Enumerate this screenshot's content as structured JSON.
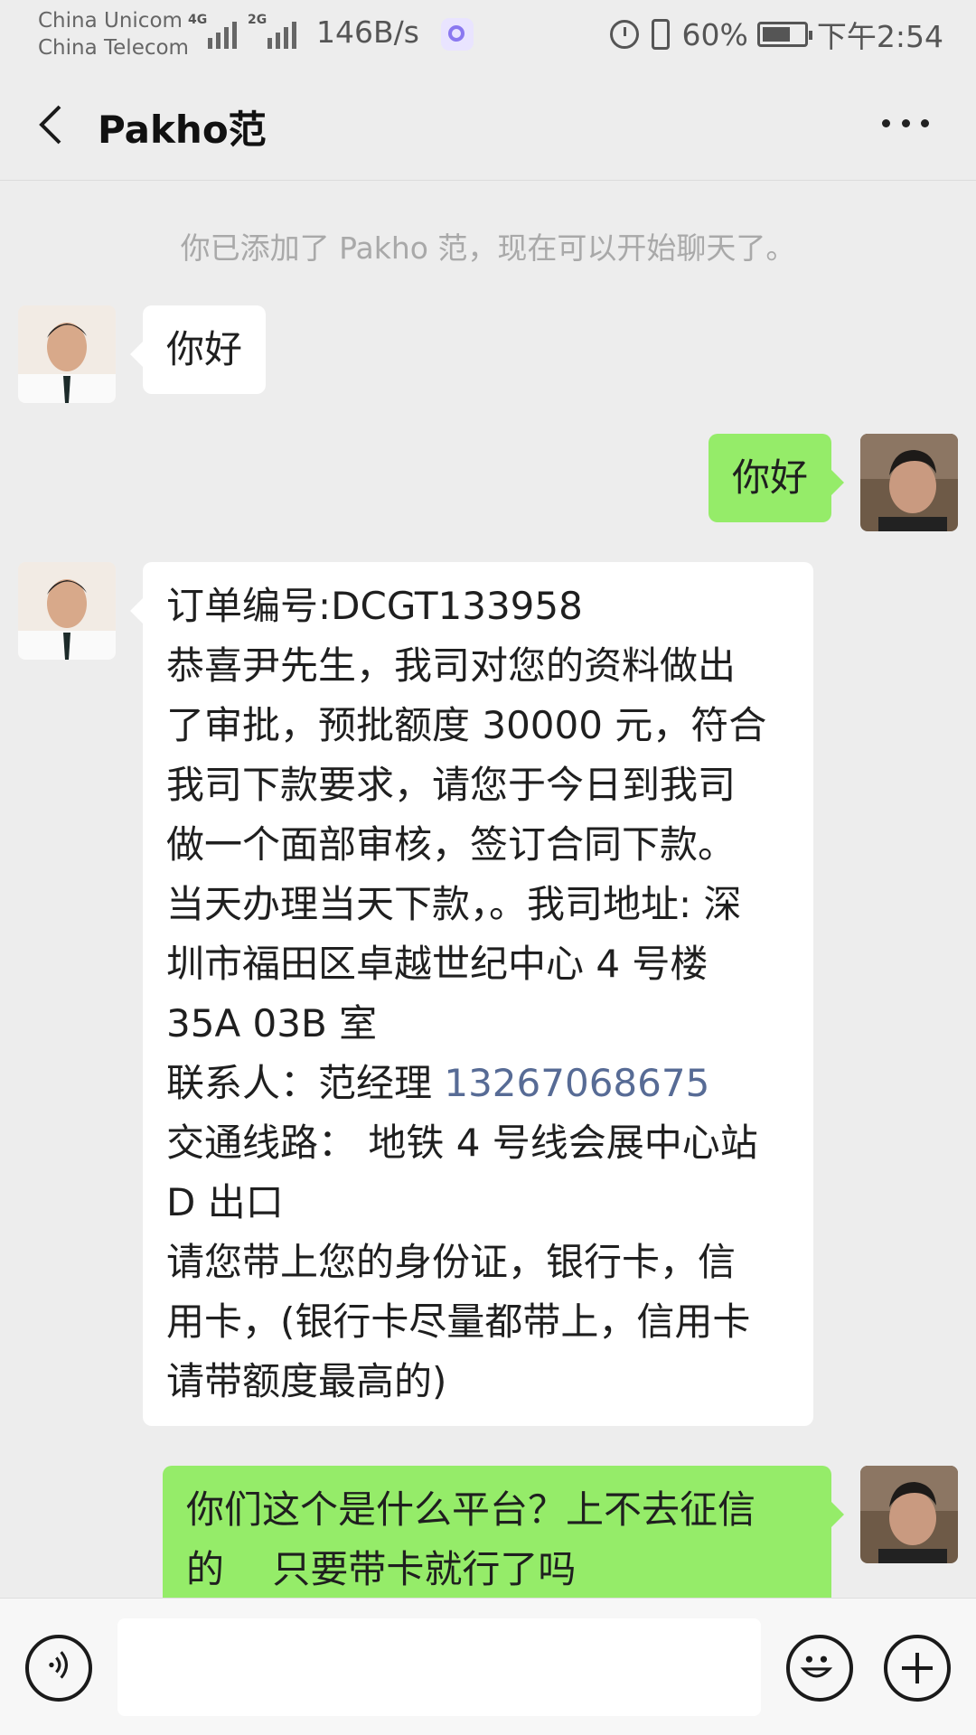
{
  "status_bar": {
    "carrier_1": "China Unicom",
    "carrier_2": "China Telecom",
    "signal_1_type": "4G",
    "signal_2_type": "2G",
    "net_speed": "146B/s",
    "battery": "60%",
    "time": "下午2:54",
    "icons": [
      "alarm-icon",
      "vibrate-icon",
      "battery-icon"
    ]
  },
  "header": {
    "title": "Pakho范",
    "back_icon": "chevron-left-icon",
    "more_icon": "more-dots-icon"
  },
  "chat": {
    "system_message": "你已添加了 Pakho 范，现在可以开始聊天了。",
    "messages": [
      {
        "direction": "in",
        "text": "你好"
      },
      {
        "direction": "out",
        "text": "你好"
      },
      {
        "direction": "in",
        "lines": [
          "订单编号:DCGT133958",
          "恭喜尹先生，我司对您的资料做出",
          "了审批，预批额度 30000 元，符合",
          "我司下款要求，请您于今日到我司",
          "做一个面部审核，签订合同下款。",
          "当天办理当天下款，。我司地址: 深",
          "圳市福田区卓越世纪中心 4 号楼",
          "35A 03B 室"
        ],
        "contact_label": "联系人：范经理 ",
        "contact_phone": "13267068675",
        "lines_after": [
          "交通线路：  地铁 4 号线会展中心站",
          "D 出口",
          "请您带上您的身份证，银行卡，信",
          "用卡，(银行卡尽量都带上，信用卡",
          "请带额度最高的)"
        ]
      },
      {
        "direction": "out",
        "lines": [
          "你们这个是什么平台？上不去征信",
          "的    只要带卡就行了吗"
        ]
      }
    ]
  },
  "input_bar": {
    "voice_icon": "voice-icon",
    "emoji_icon": "emoji-icon",
    "plus_icon": "plus-icon",
    "input_value": ""
  },
  "colors": {
    "background": "#ededed",
    "bubble_in": "#ffffff",
    "bubble_out": "#95ec69",
    "link": "#576b95",
    "system_text": "#a9a9a9"
  }
}
